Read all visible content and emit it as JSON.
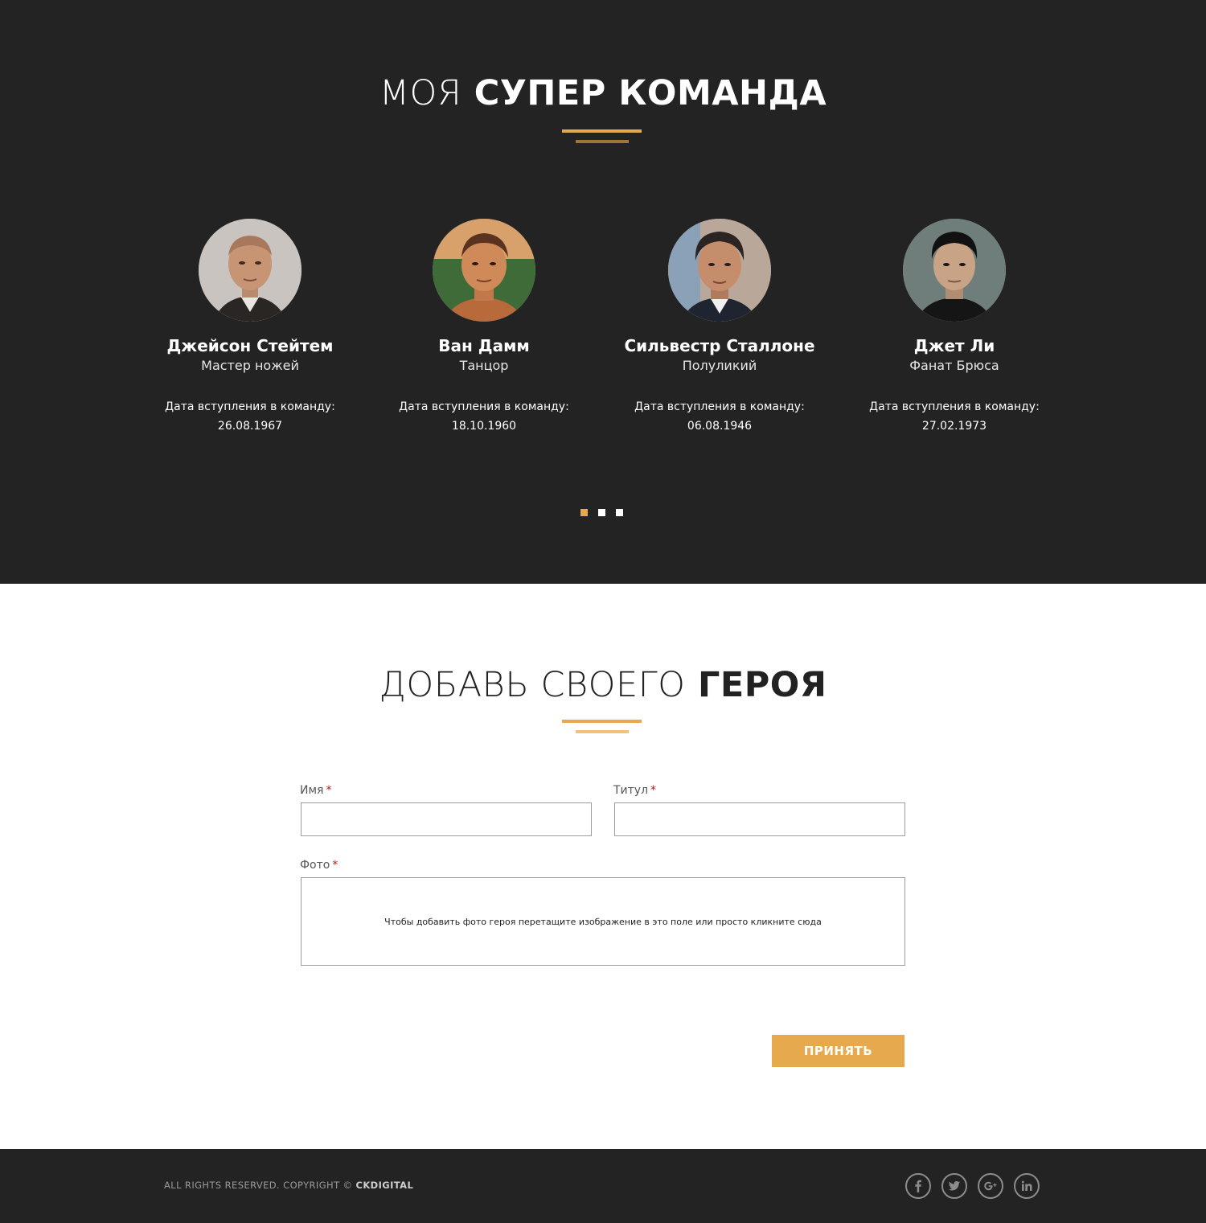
{
  "team": {
    "title_light": "МОЯ",
    "title_bold": "СУПЕР КОМАНДА",
    "members": [
      {
        "name": "Джейсон Стейтем",
        "title": "Мастер ножей",
        "join_label": "Дата вступления в команду:",
        "join_date": "26.08.1967"
      },
      {
        "name": "Ван Дамм",
        "title": "Танцор",
        "join_label": "Дата вступления в команду:",
        "join_date": "18.10.1960"
      },
      {
        "name": "Сильвестр Сталлоне",
        "title": "Полуликий",
        "join_label": "Дата вступления в команду:",
        "join_date": "06.08.1946"
      },
      {
        "name": "Джет Ли",
        "title": "Фанат Брюса",
        "join_label": "Дата вступления в команду:",
        "join_date": "27.02.1973"
      }
    ],
    "pagination": {
      "pages": 3,
      "active": 1
    }
  },
  "form": {
    "title_light": "ДОБАВЬ СВОЕГО",
    "title_bold": "ГЕРОЯ",
    "name_label": "Имя",
    "name_value": "",
    "title_label": "Титул",
    "title_value": "",
    "photo_label": "Фото",
    "required_mark": "*",
    "dropzone_text": "Чтобы добавить фото героя перетащите изображение в это поле или просто кликните сюда",
    "submit_label": "ПРИНЯТЬ"
  },
  "footer": {
    "copyright": "ALL RIGHTS RESERVED. COPYRIGHT ©",
    "brand": "CKDIGITAL",
    "socials": [
      "facebook-icon",
      "twitter-icon",
      "google-plus-icon",
      "linkedin-icon"
    ]
  },
  "colors": {
    "dark_bg": "#232323",
    "accent": "#e7a94e",
    "required": "#b31b1b"
  }
}
